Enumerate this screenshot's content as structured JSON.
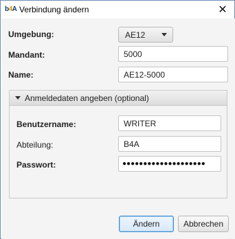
{
  "window": {
    "title": "Verbindung ändern",
    "app_icon": {
      "prefix": "b",
      "accent": "4",
      "suffix": "A"
    },
    "close_icon": "✕"
  },
  "form": {
    "environment": {
      "label": "Umgebung:",
      "value": "AE12",
      "options_visible": [
        "AE12"
      ]
    },
    "client": {
      "label": "Mandant:",
      "value": "5000"
    },
    "name": {
      "label": "Name:",
      "value": "AE12-5000"
    }
  },
  "credentials_section": {
    "header": "Anmeldedaten angeben (optional)",
    "expanded": true,
    "username": {
      "label": "Benutzername:",
      "value": "WRITER"
    },
    "department": {
      "label": "Abteilung:",
      "value": "B4A"
    },
    "password": {
      "label": "Passwort:",
      "masked_value": "●●●●●●●●●●●●●●●●●●●●"
    }
  },
  "buttons": {
    "save_label": "Ändern",
    "cancel_label": "Abbrechen"
  },
  "colors": {
    "window_border": "#6f8fb5",
    "content_bg": "#f4f4f4",
    "default_button_border": "#3c8fd0"
  }
}
